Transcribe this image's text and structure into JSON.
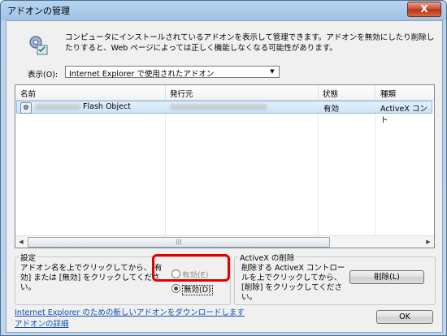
{
  "window": {
    "title": "アドオンの管理",
    "close_label": "X"
  },
  "description": "コンピュータにインストールされているアドオンを表示して管理できます。アドオンを無効にしたり削除したりすると、Web ページによっては正しく機能しなくなる可能性があります。",
  "show": {
    "label": "表示(O):",
    "selected": "Internet Explorer で使用されたアドオン"
  },
  "list": {
    "columns": [
      "名前",
      "発行元",
      "状態",
      "種類"
    ],
    "rows": [
      {
        "name": "Flash Object",
        "publisher": "",
        "status": "有効",
        "type": "ActiveX コント"
      }
    ],
    "scroll_thumb_glyph": "|||"
  },
  "settings": {
    "label": "設定",
    "instructions": "アドオン名を上でクリックしてから、[有効] または [無効] をクリックしてください。",
    "enable_label": "有効(E)",
    "disable_label": "無効(D)"
  },
  "activex": {
    "label": "ActiveX の削除",
    "instructions": "削除する ActiveX コントロールを上でクリックしてから、[削除] をクリックしてください。",
    "delete_label": "削除(L)"
  },
  "footer": {
    "download_link": "Internet Explorer のための新しいアドオンをダウンロードします",
    "details_link": "アドオンの詳細",
    "ok_label": "OK"
  }
}
